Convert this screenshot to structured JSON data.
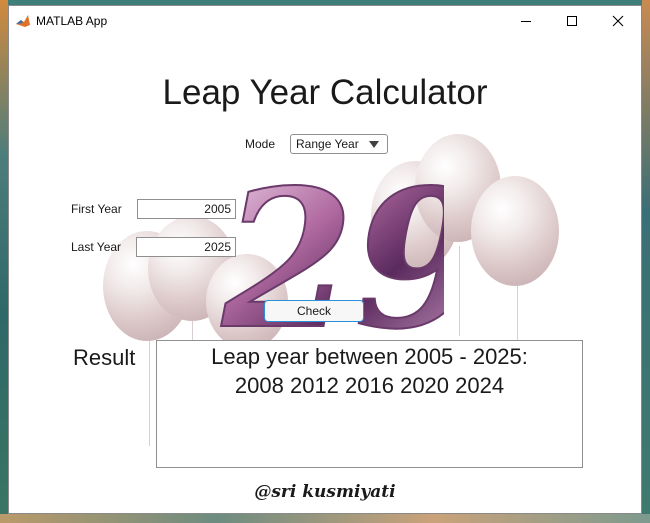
{
  "window": {
    "title": "MATLAB App"
  },
  "app": {
    "heading": "Leap Year Calculator",
    "mode_label": "Mode",
    "mode_value": "Range Year",
    "first_year_label": "First Year",
    "first_year_value": "2005",
    "last_year_label": "Last Year",
    "last_year_value": "2025",
    "check_label": "Check",
    "result_label": "Result",
    "result_line1": "Leap year between 2005 - 2025:",
    "result_line2": "2008  2012  2016  2020  2024",
    "credit": "@sri kusmiyati",
    "decoration_text": "29"
  },
  "colors": {
    "accent": "#2a90d8",
    "balloon": "#dcc8c9",
    "number_art": "#a0508a"
  },
  "icons": [
    "matlab-icon",
    "minimize-icon",
    "maximize-icon",
    "close-icon",
    "chevron-down-icon"
  ]
}
